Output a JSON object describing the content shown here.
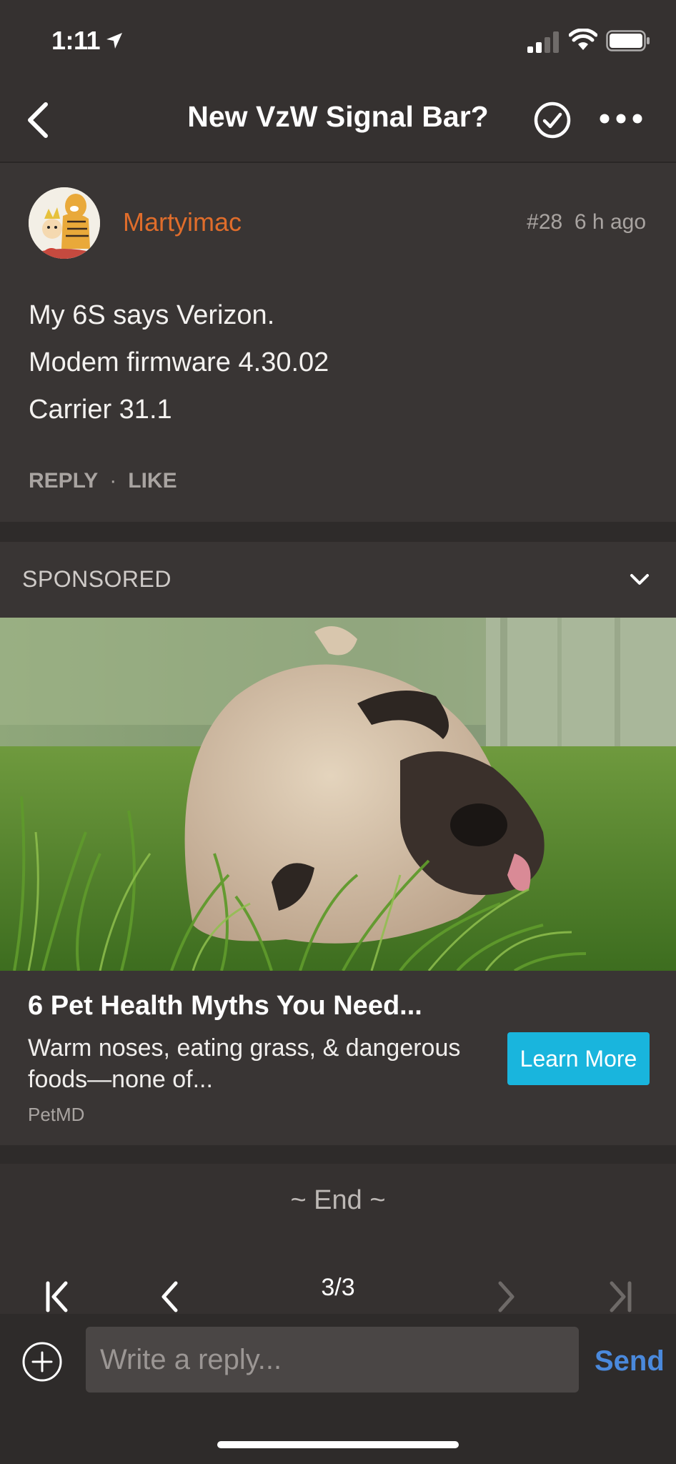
{
  "status_bar": {
    "time": "1:11"
  },
  "nav": {
    "title": "New VzW Signal Bar?"
  },
  "post": {
    "username": "Martyimac",
    "number": "#28",
    "time_ago": "6 h ago",
    "body_lines": [
      "My 6S says Verizon.",
      "Modem firmware 4.30.02",
      "Carrier 31.1"
    ],
    "reply_label": "REPLY",
    "separator": "·",
    "like_label": "LIKE"
  },
  "sponsored": {
    "label": "SPONSORED",
    "title": "6 Pet Health Myths You Need...",
    "description": "Warm noses, eating grass, & dangerous foods—none of...",
    "source": "PetMD",
    "cta_label": "Learn More"
  },
  "thread": {
    "end_label": "~ End ~"
  },
  "pagination": {
    "current_page": 3,
    "total_pages": 3,
    "page_label": "3/3"
  },
  "composer": {
    "placeholder": "Write a reply...",
    "send_label": "Send"
  },
  "colors": {
    "background": "#353130",
    "card": "#393534",
    "username": "#e06d2b",
    "cta": "#19b5dd",
    "send": "#4a89dc"
  }
}
